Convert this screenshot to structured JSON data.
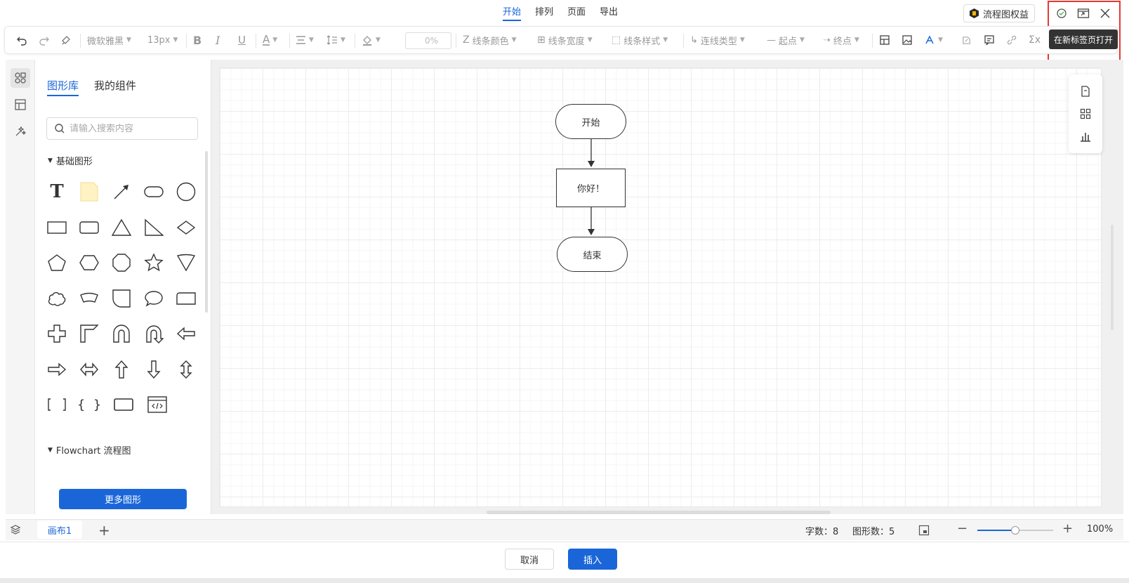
{
  "menu": {
    "tabs": [
      "开始",
      "排列",
      "页面",
      "导出"
    ],
    "active": 0
  },
  "rights_button": "流程图权益",
  "window_controls": {
    "tooltip": "在新标签页打开"
  },
  "toolbar": {
    "font_family": "微软雅黑",
    "font_size": "13px",
    "opacity": "0%",
    "line_color": "线条颜色",
    "line_width": "线条宽度",
    "line_style": "线条样式",
    "connector_type": "连线类型",
    "start_point": "起点",
    "end_point": "终点"
  },
  "library": {
    "tabs": [
      "图形库",
      "我的组件"
    ],
    "search_placeholder": "请输入搜索内容",
    "section_basic": "基础图形",
    "section_flowchart": "Flowchart 流程图",
    "more_button": "更多图形"
  },
  "diagram": {
    "nodes": [
      {
        "label": "开始",
        "shape": "terminator"
      },
      {
        "label": "你好！",
        "shape": "process"
      },
      {
        "label": "结束",
        "shape": "terminator"
      }
    ]
  },
  "statusbar": {
    "page_tab": "画布1",
    "char_count_label": "字数：",
    "char_count": "8",
    "shape_count_label": "图形数：",
    "shape_count": "5",
    "zoom": "100%",
    "zoom_level": 0.5
  },
  "footer": {
    "cancel": "取消",
    "insert": "插入"
  },
  "colors": {
    "accent": "#1a66d9",
    "highlight_border": "#e53935"
  }
}
